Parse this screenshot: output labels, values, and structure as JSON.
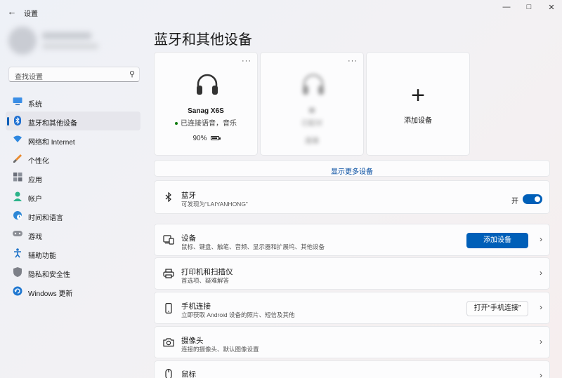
{
  "window": {
    "title": "设置"
  },
  "search": {
    "placeholder": "查找设置"
  },
  "sidebar": {
    "items": [
      {
        "label": "系统",
        "icon": "monitor-icon"
      },
      {
        "label": "蓝牙和其他设备",
        "icon": "bluetooth-icon"
      },
      {
        "label": "网络和 Internet",
        "icon": "wifi-icon"
      },
      {
        "label": "个性化",
        "icon": "brush-icon"
      },
      {
        "label": "应用",
        "icon": "apps-icon"
      },
      {
        "label": "帐户",
        "icon": "person-icon"
      },
      {
        "label": "时间和语言",
        "icon": "globe-clock-icon"
      },
      {
        "label": "游戏",
        "icon": "gamepad-icon"
      },
      {
        "label": "辅助功能",
        "icon": "accessibility-icon"
      },
      {
        "label": "隐私和安全性",
        "icon": "shield-icon"
      },
      {
        "label": "Windows 更新",
        "icon": "update-icon"
      }
    ],
    "active_index": 1
  },
  "main": {
    "title": "蓝牙和其他设备",
    "devices": [
      {
        "name": "Sanag X6S",
        "status": "已连接语音，音乐",
        "battery": "90%",
        "battery_level": 0.9,
        "more": "···"
      },
      {
        "name": "lll",
        "status": "已配对",
        "action": "连接",
        "more": "···"
      }
    ],
    "add_device_card": {
      "label": "添加设备",
      "plus": "+"
    },
    "show_more": "显示更多设备",
    "bluetooth": {
      "title": "蓝牙",
      "subtitle": "可发现为“LAIYANHONG”",
      "toggle_label": "开",
      "on": true
    },
    "rows": [
      {
        "title": "设备",
        "subtitle": "鼠标、键盘、触笔、音频、显示器和扩展坞、其他设备",
        "button": "添加设备",
        "icon": "devices-icon"
      },
      {
        "title": "打印机和扫描仪",
        "subtitle": "首选项、疑难解答",
        "icon": "printer-icon"
      },
      {
        "title": "手机连接",
        "subtitle": "立即获取 Android 设备的照片、短信及其他",
        "button": "打开“手机连接”",
        "icon": "phone-icon"
      },
      {
        "title": "摄像头",
        "subtitle": "连接的摄像头、默认图像设置",
        "icon": "camera-icon"
      },
      {
        "title": "鼠标",
        "icon": "mouse-icon"
      }
    ]
  },
  "colors": {
    "accent": "#005fb8",
    "link": "#004a9f",
    "connected": "#0f7b0f"
  }
}
